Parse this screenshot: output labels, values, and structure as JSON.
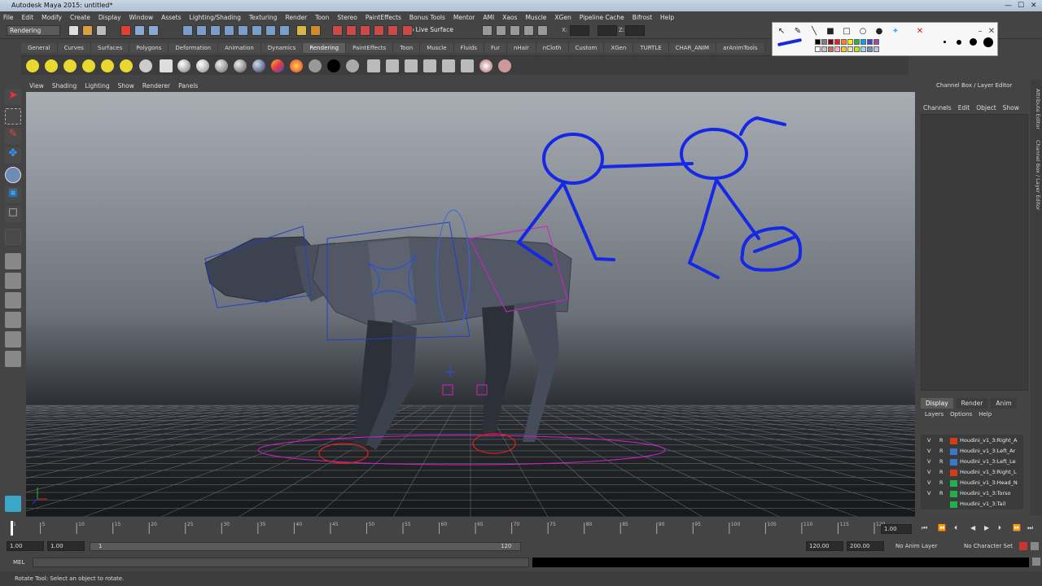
{
  "window": {
    "title": "Autodesk Maya 2015: untitled*"
  },
  "menubar": [
    "File",
    "Edit",
    "Modify",
    "Create",
    "Display",
    "Window",
    "Assets",
    "Lighting/Shading",
    "Texturing",
    "Render",
    "Toon",
    "Stereo",
    "PaintEffects",
    "Bonus Tools",
    "Mentor",
    "AMI",
    "Xaos",
    "Muscle",
    "XGen",
    "Pipeline Cache",
    "Bifrost",
    "Help"
  ],
  "status_line": {
    "mode": "Rendering",
    "live_surface": "No Live Surface",
    "x": "X:",
    "y": "Y:",
    "z": "Z:"
  },
  "shelf_tabs": [
    "General",
    "Curves",
    "Surfaces",
    "Polygons",
    "Deformation",
    "Animation",
    "Dynamics",
    "Rendering",
    "PaintEffects",
    "Toon",
    "Muscle",
    "Fluids",
    "Fur",
    "nHair",
    "nCloth",
    "Custom",
    "XGen",
    "TURTLE",
    "CHAR_ANIM",
    "arAnimTools"
  ],
  "active_shelf": "Rendering",
  "panel_menu": [
    "View",
    "Shading",
    "Lighting",
    "Show",
    "Renderer",
    "Panels"
  ],
  "right_panel": {
    "title": "Channel Box / Layer Editor",
    "menu": [
      "Channels",
      "Edit",
      "Object",
      "Show"
    ],
    "layer_tabs": [
      "Display",
      "Render",
      "Anim"
    ],
    "active_layer_tab": "Display",
    "layer_menu": [
      "Layers",
      "Options",
      "Help"
    ]
  },
  "side_tabs": [
    "Attribute Editor",
    "Channel Box / Layer Editor"
  ],
  "layers": [
    {
      "v": "V",
      "r": "R",
      "color": "#d63a16",
      "name": "Houdini_v1_3:Right_A"
    },
    {
      "v": "V",
      "r": "R",
      "color": "#3a78c8",
      "name": "Houdini_v1_3:Left_Ar"
    },
    {
      "v": "V",
      "r": "R",
      "color": "#3a78c8",
      "name": "Houdini_v1_3:Left_Le"
    },
    {
      "v": "V",
      "r": "R",
      "color": "#d63a16",
      "name": "Houdini_v1_3:Right_L"
    },
    {
      "v": "V",
      "r": "R",
      "color": "#20b050",
      "name": "Houdini_v1_3:Head_N"
    },
    {
      "v": "V",
      "r": "R",
      "color": "#20b050",
      "name": "Houdini_v1_3:Torso"
    },
    {
      "v": "",
      "r": "",
      "color": "#20b050",
      "name": "Houdini_v1_3:Tail"
    }
  ],
  "timeline": {
    "ticks": [
      "1",
      "5",
      "10",
      "15",
      "20",
      "25",
      "30",
      "35",
      "40",
      "45",
      "50",
      "55",
      "60",
      "65",
      "70",
      "75",
      "80",
      "85",
      "90",
      "95",
      "100",
      "105",
      "110",
      "115",
      "120"
    ],
    "current_frame": "1.00"
  },
  "range": {
    "start": "1.00",
    "range_start": "1.00",
    "slider_start": "1",
    "slider_end": "120",
    "range_end": "120.00",
    "end": "200.00",
    "anim_layer": "No Anim Layer",
    "char_set": "No Character Set"
  },
  "cmd": {
    "label": "MEL"
  },
  "help_line": "Rotate Tool: Select an object to rotate.",
  "paint_toolbar": {
    "swatches": [
      "#000000",
      "#7f7f7f",
      "#880015",
      "#ed1c24",
      "#ff7f27",
      "#fff200",
      "#22b14c",
      "#00a2e8",
      "#3f48cc",
      "#a349a4",
      "#ffffff",
      "#c3c3c3",
      "#b97a57",
      "#ffaec9",
      "#ffc90e",
      "#efe4b0",
      "#b5e61d",
      "#99d9ea",
      "#7092be",
      "#c8bfe7"
    ]
  },
  "colors": {
    "annotation_blue": "#1428e6",
    "rig_magenta": "#d020c8",
    "rig_red": "#e02020"
  }
}
